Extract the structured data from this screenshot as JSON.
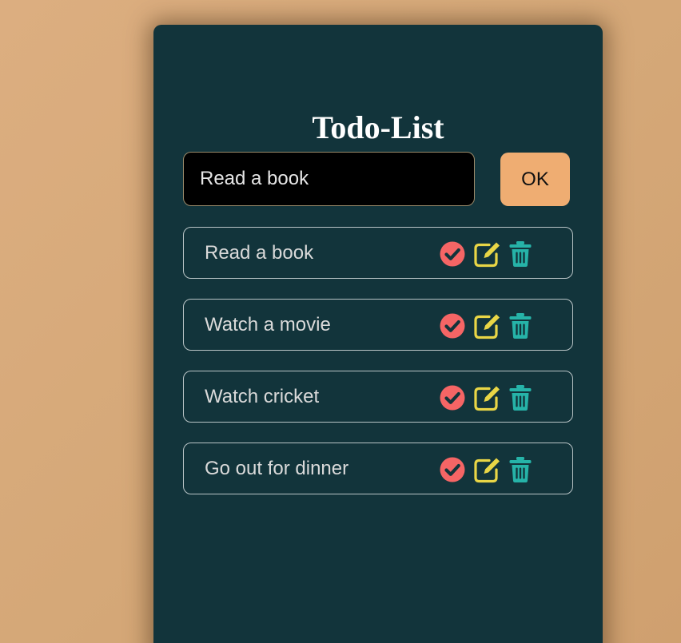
{
  "app": {
    "title": "Todo-List"
  },
  "input": {
    "value": "Read a book",
    "placeholder": "Read a book"
  },
  "ok_button": {
    "label": "OK"
  },
  "tasks": [
    {
      "label": "Read a book"
    },
    {
      "label": "Watch a movie"
    },
    {
      "label": "Watch cricket"
    },
    {
      "label": "Go out for dinner"
    }
  ],
  "icons": {
    "complete": {
      "name": "check-circle-icon",
      "color": "#f56565"
    },
    "edit": {
      "name": "pen-square-icon",
      "color": "#e9d646"
    },
    "delete": {
      "name": "trash-icon",
      "color": "#26b3a8"
    }
  },
  "colors": {
    "background": "#d6a877",
    "card": "#12343b",
    "ok_button": "#efad72",
    "input_background": "#000000"
  }
}
